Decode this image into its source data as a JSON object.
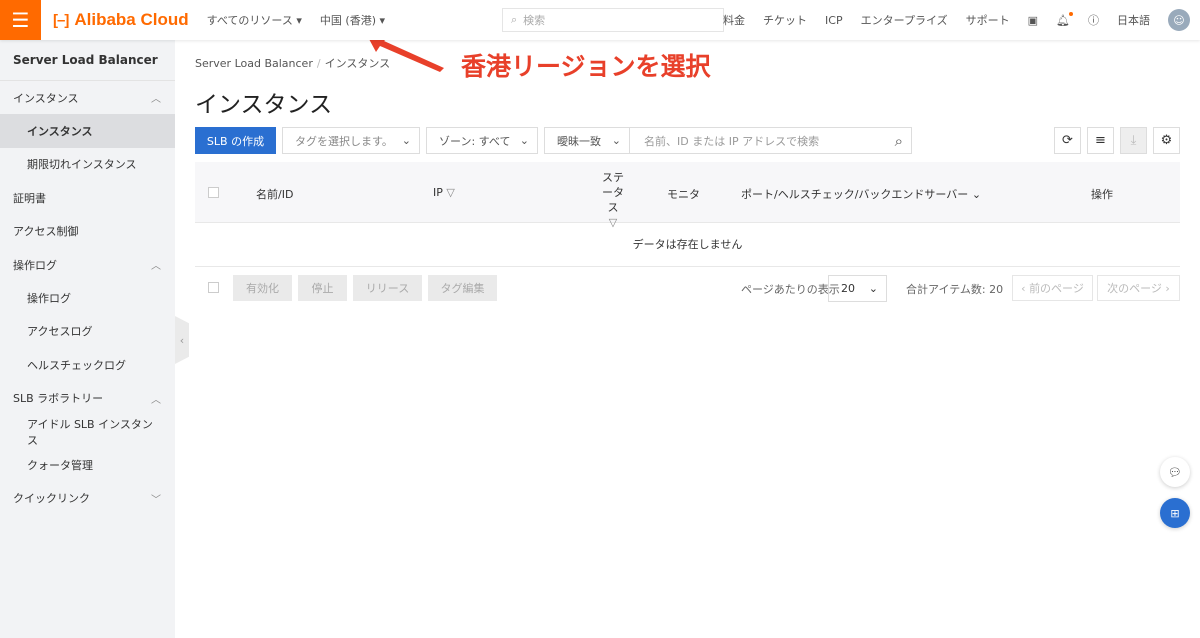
{
  "topbar": {
    "logo": "Alibaba Cloud",
    "resources": "すべてのリソース",
    "region": "中国 (香港)",
    "search_placeholder": "検索",
    "links": [
      "料金",
      "チケット",
      "ICP",
      "エンタープライズ",
      "サポート"
    ],
    "language": "日本語"
  },
  "sidebar": {
    "title": "Server Load Balancer",
    "items": [
      {
        "label": "インスタンス",
        "type": "group",
        "expanded": true
      },
      {
        "label": "インスタンス",
        "type": "sub",
        "active": true
      },
      {
        "label": "期限切れインスタンス",
        "type": "sub"
      },
      {
        "label": "証明書",
        "type": "item"
      },
      {
        "label": "アクセス制御",
        "type": "item"
      },
      {
        "label": "操作ログ",
        "type": "group",
        "expanded": true
      },
      {
        "label": "操作ログ",
        "type": "sub"
      },
      {
        "label": "アクセスログ",
        "type": "sub"
      },
      {
        "label": "ヘルスチェックログ",
        "type": "sub"
      },
      {
        "label": "SLB ラボラトリー",
        "type": "group",
        "expanded": true
      },
      {
        "label": "アイドル SLB インスタンス",
        "type": "sub"
      },
      {
        "label": "クォータ管理",
        "type": "sub"
      },
      {
        "label": "クイックリンク",
        "type": "group",
        "expanded": false
      }
    ]
  },
  "main": {
    "breadcrumb": [
      "Server Load Balancer",
      "インスタンス"
    ],
    "title": "インスタンス",
    "create_button": "SLB の作成",
    "tag_select": "タグを選択します。",
    "zone_select": "ゾーン: すべて",
    "match_select": "曖昧一致",
    "search_placeholder": "名前、ID または IP アドレスで検索",
    "columns": [
      "名前/ID",
      "IP",
      "ステータス",
      "モニタ",
      "ポート/ヘルスチェック/バックエンドサーバー",
      "操作"
    ],
    "empty": "データは存在しません",
    "bulk_actions": [
      "有効化",
      "停止",
      "リリース",
      "タグ編集"
    ],
    "page_size_label": "ページあたりの表示",
    "page_size": "20",
    "total": "合計アイテム数: 20",
    "prev": "前のページ",
    "next": "次のページ"
  },
  "annotation": "香港リージョンを選択",
  "colors": {
    "brand": "#ff6a00",
    "primary": "#2a6fd1",
    "annotation": "#e8402a"
  }
}
